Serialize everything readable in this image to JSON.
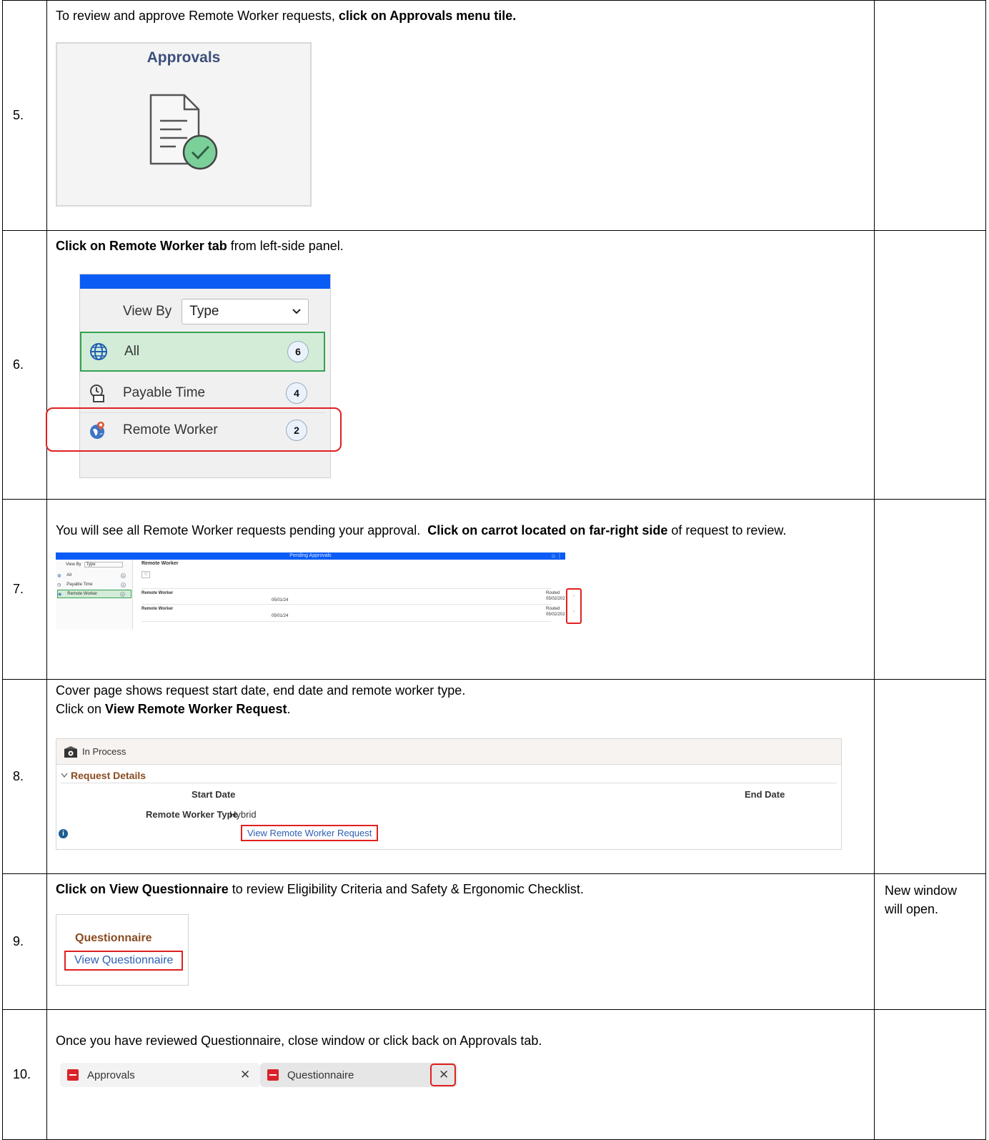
{
  "steps": [
    {
      "number": "5.",
      "instruction_plain": "To review and approve Remote Worker requests, ",
      "instruction_bold": "click on Approvals menu tile.",
      "tile": {
        "title": "Approvals",
        "icon": "document-check-icon"
      },
      "note": ""
    },
    {
      "number": "6.",
      "instruction_bold": "Click on Remote Worker tab",
      "instruction_plain": " from left-side panel.",
      "panel": {
        "view_by_label": "View By",
        "view_by_value": "Type",
        "items": [
          {
            "label": "All",
            "count": "6",
            "icon": "globe-icon"
          },
          {
            "label": "Payable Time",
            "count": "4",
            "icon": "clock-calendar-icon"
          },
          {
            "label": "Remote Worker",
            "count": "2",
            "icon": "globe-pin-icon"
          }
        ]
      },
      "note": ""
    },
    {
      "number": "7.",
      "instruction_plain_1": "You will see all Remote Worker requests pending your approval.  ",
      "instruction_bold": "Click on carrot located on far-right side",
      "instruction_plain_2": " of request to review.",
      "pending": {
        "bar_title": "Pending Approvals",
        "view_by_label": "View By",
        "view_by_value": "Type",
        "side_items": [
          {
            "label": "All",
            "count": "6"
          },
          {
            "label": "Payable Time",
            "count": "4"
          },
          {
            "label": "Remote Worker",
            "count": "2"
          }
        ],
        "main_title": "Remote Worker",
        "rows": [
          {
            "type": "Remote Worker",
            "date": "05/01/24",
            "status": "Routed",
            "status_date": "05/02/202"
          },
          {
            "type": "Remote Worker",
            "date": "05/01/24",
            "status": "Routed",
            "status_date": "05/02/202"
          }
        ]
      },
      "note": ""
    },
    {
      "number": "8.",
      "instruction_line1": "Cover page shows request start date, end date and remote worker type.",
      "instruction_line2_plain": "Click on ",
      "instruction_line2_bold": "View Remote Worker Request",
      "instruction_line2_end": ".",
      "cover": {
        "status": "In Process",
        "section": "Request Details",
        "start_label": "Start Date",
        "end_label": "End Date",
        "type_label": "Remote Worker Type",
        "type_value": "Hybrid",
        "link": "View Remote Worker Request"
      },
      "note": ""
    },
    {
      "number": "9.",
      "instruction_bold": "Click on View Questionnaire",
      "instruction_plain": " to review Eligibility Criteria and Safety & Ergonomic Checklist.",
      "questionnaire": {
        "title": "Questionnaire",
        "link": "View Questionnaire"
      },
      "note": "New window will open."
    },
    {
      "number": "10.",
      "instruction_plain": "Once you have reviewed Questionnaire, close window or click back on Approvals tab.",
      "tabs": [
        {
          "label": "Approvals"
        },
        {
          "label": "Questionnaire"
        }
      ],
      "note": ""
    }
  ],
  "colors": {
    "blue_bar": "#0a5cf5",
    "highlight_red": "#e02020",
    "selected_green": "#d3ecd8",
    "link_blue": "#2d5fb4",
    "section_brown": "#8a4b21"
  }
}
